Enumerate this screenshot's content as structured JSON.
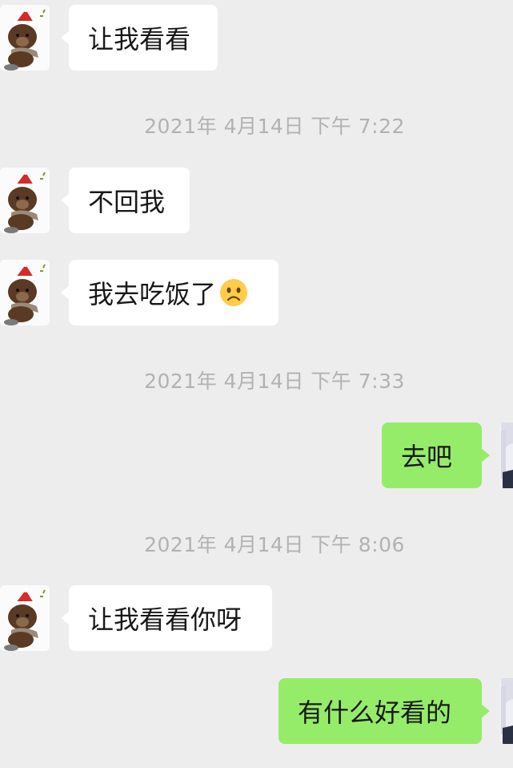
{
  "messages": [
    {
      "type": "incoming",
      "text": "让我看看"
    },
    {
      "type": "timestamp",
      "text": "2021年 4月14日 下午 7:22"
    },
    {
      "type": "incoming",
      "text": "不回我"
    },
    {
      "type": "incoming",
      "text": "我去吃饭了",
      "emoji": "frowning-face-emoji"
    },
    {
      "type": "timestamp",
      "text": "2021年 4月14日 下午 7:33"
    },
    {
      "type": "outgoing",
      "text": "去吧"
    },
    {
      "type": "timestamp",
      "text": "2021年 4月14日 下午 8:06"
    },
    {
      "type": "incoming",
      "text": "让我看看你呀"
    },
    {
      "type": "outgoing",
      "text": "有什么好看的"
    }
  ],
  "avatars": {
    "contact": "brown-bear-santa-hat-avatar-icon",
    "self": "anime-character-avatar-icon"
  },
  "colors": {
    "background": "#ededed",
    "incoming_bubble": "#ffffff",
    "outgoing_bubble": "#95ec69",
    "timestamp": "#b2b2b2"
  }
}
